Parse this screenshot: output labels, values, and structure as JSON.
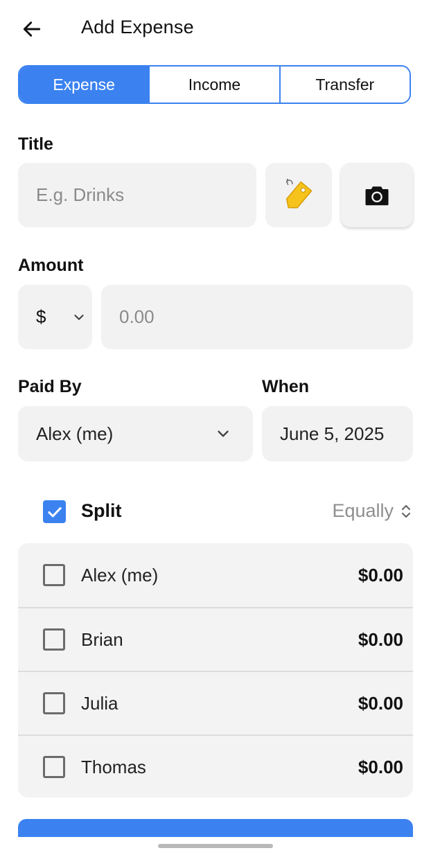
{
  "header": {
    "title": "Add Expense",
    "back_icon": "arrow-left-icon"
  },
  "tabs": [
    {
      "label": "Expense",
      "active": true
    },
    {
      "label": "Income",
      "active": false
    },
    {
      "label": "Transfer",
      "active": false
    }
  ],
  "title_field": {
    "label": "Title",
    "placeholder": "E.g. Drinks",
    "value": "",
    "tag_icon": "tag-icon",
    "camera_icon": "camera-icon"
  },
  "amount_field": {
    "label": "Amount",
    "currency": "$",
    "placeholder": "0.00",
    "value": ""
  },
  "paid_by": {
    "label": "Paid By",
    "value": "Alex (me)"
  },
  "when": {
    "label": "When",
    "value": "June 5, 2025"
  },
  "split": {
    "label": "Split",
    "checked": true,
    "mode": "Equally"
  },
  "members": [
    {
      "name": "Alex (me)",
      "amount": "$0.00",
      "checked": false
    },
    {
      "name": "Brian",
      "amount": "$0.00",
      "checked": false
    },
    {
      "name": "Julia",
      "amount": "$0.00",
      "checked": false
    },
    {
      "name": "Thomas",
      "amount": "$0.00",
      "checked": false
    }
  ],
  "colors": {
    "accent": "#3b82f0",
    "field_bg": "#f2f2f2"
  }
}
